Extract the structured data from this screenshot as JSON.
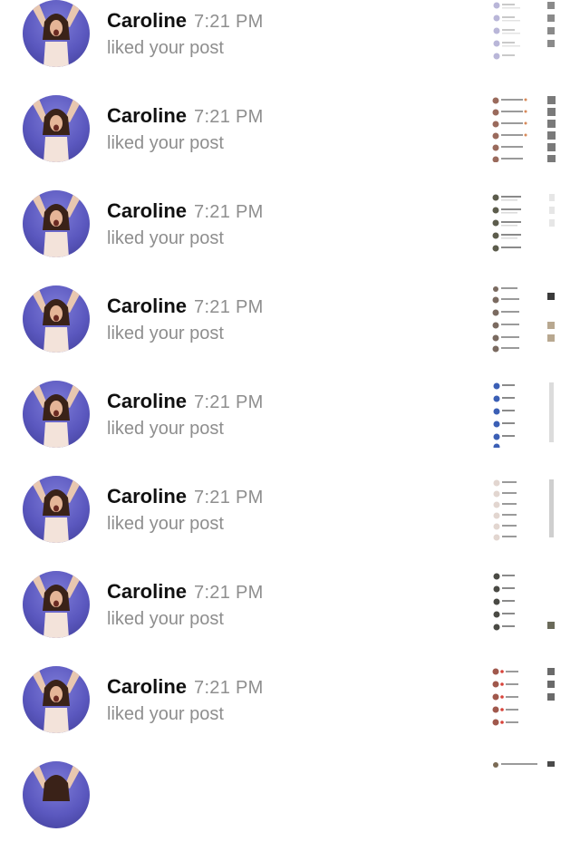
{
  "notifications": [
    {
      "username": "Caroline",
      "time": "7:21 PM",
      "action": "liked your post"
    },
    {
      "username": "Caroline",
      "time": "7:21 PM",
      "action": "liked your post"
    },
    {
      "username": "Caroline",
      "time": "7:21 PM",
      "action": "liked your post"
    },
    {
      "username": "Caroline",
      "time": "7:21 PM",
      "action": "liked your post"
    },
    {
      "username": "Caroline",
      "time": "7:21 PM",
      "action": "liked your post"
    },
    {
      "username": "Caroline",
      "time": "7:21 PM",
      "action": "liked your post"
    },
    {
      "username": "Caroline",
      "time": "7:21 PM",
      "action": "liked your post"
    },
    {
      "username": "Caroline",
      "time": "7:21 PM",
      "action": "liked your post"
    },
    {
      "username": "",
      "time": "",
      "action": ""
    }
  ],
  "colors": {
    "avatar_bg": "#5b58bf",
    "username_text": "#111111",
    "secondary_text": "#8e8e8e",
    "background": "#ffffff"
  }
}
